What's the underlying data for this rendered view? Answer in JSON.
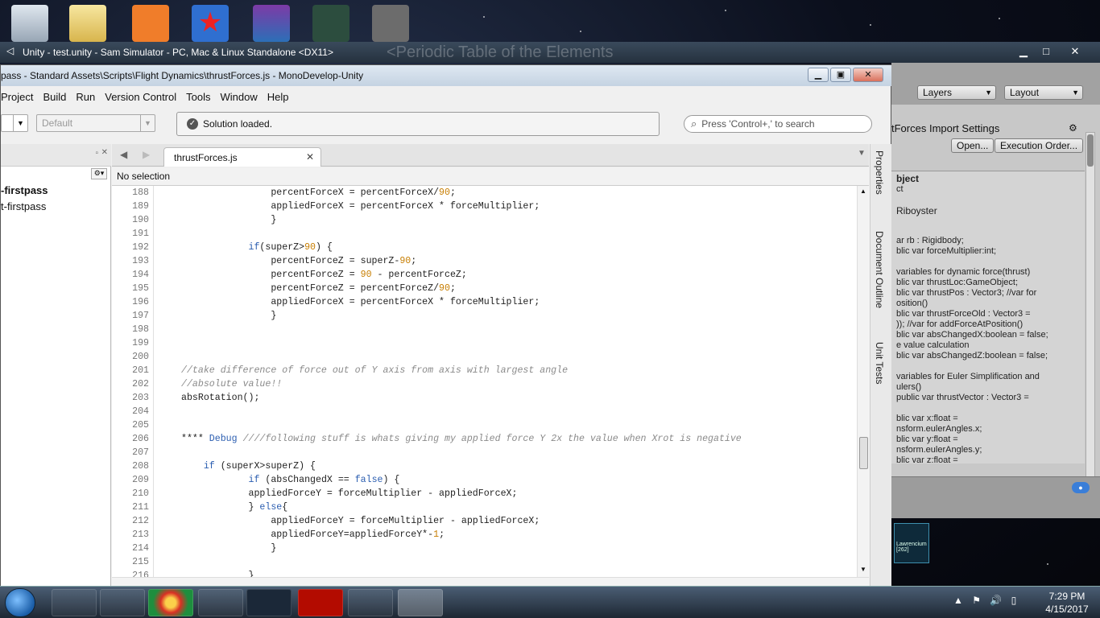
{
  "unity_window": {
    "title": "Unity - test.unity - Sam Simulator - PC, Mac & Linux Standalone <DX11>",
    "background_text": "<Periodic Table of the Elements",
    "layers": "Layers",
    "layout": "Layout",
    "inspector_title": "tForces Import Settings",
    "open_btn": "Open...",
    "exec_btn": "Execution Order...",
    "inspector_lines": [
      "bject",
      "ct",
      "Riboyster",
      "ar rb : Rigidbody;",
      "blic var forceMultiplier:int;",
      "variables for dynamic force(thrust)",
      "blic var thrustLoc:GameObject;",
      "blic var thrustPos : Vector3; //var for",
      "osition()",
      "blic var thrustForceOld : Vector3 =",
      ")); //var for addForceAtPosition()",
      "blic var absChangedX:boolean = false;",
      "e value calculation",
      "blic var absChangedZ:boolean = false;",
      "variables for Euler Simplification and",
      "ulers()",
      "public var thrustVector : Vector3 =",
      "blic var x:float =",
      "nsform.eulerAngles.x;",
      "blic var y:float =",
      "nsform.eulerAngles.y;",
      "blic var z:float ="
    ],
    "gallery_label": "Lawrencium [262]"
  },
  "monodevelop": {
    "title": "pass - Standard Assets\\Scripts\\Flight Dynamics\\thrustForces.js - MonoDevelop-Unity",
    "menu": [
      "Project",
      "Build",
      "Run",
      "Version Control",
      "Tools",
      "Window",
      "Help"
    ],
    "config_combo": "Default",
    "status": "Solution loaded.",
    "search_placeholder": "Press 'Control+,' to search",
    "solution_items": [
      "-firstpass",
      "t-firstpass"
    ],
    "tab": "thrustForces.js",
    "selection": "No selection",
    "side_tabs": [
      "Properties",
      "Document Outline",
      "Unit Tests"
    ],
    "lines": [
      {
        "n": "188",
        "code": "                percentForceX = percentForceX/90;"
      },
      {
        "n": "189",
        "code": "                appliedForceX = percentForceX * forceMultiplier;"
      },
      {
        "n": "190",
        "code": "                }"
      },
      {
        "n": "191",
        "code": ""
      },
      {
        "n": "192",
        "code": "            if(superZ>90) {"
      },
      {
        "n": "193",
        "code": "                percentForceZ = superZ-90;"
      },
      {
        "n": "194",
        "code": "                percentForceZ = 90 - percentForceZ;"
      },
      {
        "n": "195",
        "code": "                percentForceZ = percentForceZ/90;"
      },
      {
        "n": "196",
        "code": "                appliedForceX = percentForceX * forceMultiplier;"
      },
      {
        "n": "197",
        "code": "                }"
      },
      {
        "n": "198",
        "code": ""
      },
      {
        "n": "199",
        "code": ""
      },
      {
        "n": "200",
        "code": ""
      },
      {
        "n": "201",
        "code": "//take difference of force out of Y axis from axis with largest angle"
      },
      {
        "n": "202",
        "code": "//absolute value!!"
      },
      {
        "n": "203",
        "code": "absRotation();"
      },
      {
        "n": "204",
        "code": ""
      },
      {
        "n": "205",
        "code": ""
      },
      {
        "n": "206",
        "code": "**** Debug ////following stuff is whats giving my applied force Y 2x the value when Xrot is negative"
      },
      {
        "n": "207",
        "code": ""
      },
      {
        "n": "208",
        "code": "    if (superX>superZ) {"
      },
      {
        "n": "209",
        "code": "            if (absChangedX == false) {"
      },
      {
        "n": "210",
        "code": "            appliedForceY = forceMultiplier - appliedForceX;"
      },
      {
        "n": "211",
        "code": "            } else{"
      },
      {
        "n": "212",
        "code": "                appliedForceY = forceMultiplier - appliedForceX;"
      },
      {
        "n": "213",
        "code": "                appliedForceY=appliedForceY*-1;"
      },
      {
        "n": "214",
        "code": "                }"
      },
      {
        "n": "215",
        "code": ""
      },
      {
        "n": "216",
        "code": "            }"
      }
    ]
  },
  "taskbar": {
    "time": "7:29 PM",
    "date": "4/15/2017"
  },
  "colors": {
    "comment": "#8a8a8a",
    "keyword": "#2a5db0",
    "number": "#c77d00"
  }
}
